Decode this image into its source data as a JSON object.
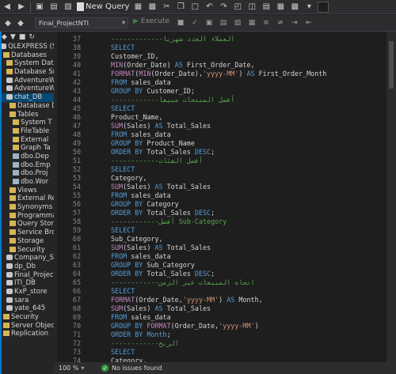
{
  "toolbar": {
    "new_query_label": "New Query"
  },
  "toolbar2": {
    "database_selected": "Final_ProjectNTI",
    "execute_label": "Execute"
  },
  "object_explorer": {
    "items": [
      {
        "label": "QLEXPRESS (SQL",
        "icon": "server-icon"
      },
      {
        "label": "Databases",
        "icon": "folder-icon"
      },
      {
        "label": "System Databa",
        "icon": "folder-icon"
      },
      {
        "label": "Database Snap",
        "icon": "folder-icon"
      },
      {
        "label": "AdventureWor",
        "icon": "database-icon"
      },
      {
        "label": "AdventureWor",
        "icon": "database-icon"
      },
      {
        "label": "chat_DB",
        "icon": "database-icon"
      },
      {
        "label": "Database D",
        "icon": "folder-icon"
      },
      {
        "label": "Tables",
        "icon": "folder-icon"
      },
      {
        "label": "System T",
        "icon": "folder-icon"
      },
      {
        "label": "FileTable",
        "icon": "folder-icon"
      },
      {
        "label": "External",
        "icon": "folder-icon"
      },
      {
        "label": "Graph Ta",
        "icon": "folder-icon"
      },
      {
        "label": "dbo.Dep",
        "icon": "table-icon"
      },
      {
        "label": "dbo.Emp",
        "icon": "table-icon"
      },
      {
        "label": "dbo.Proj",
        "icon": "table-icon"
      },
      {
        "label": "dbo.Wor",
        "icon": "table-icon"
      },
      {
        "label": "Views",
        "icon": "folder-icon"
      },
      {
        "label": "External Re",
        "icon": "folder-icon"
      },
      {
        "label": "Synonyms",
        "icon": "folder-icon"
      },
      {
        "label": "Programma",
        "icon": "folder-icon"
      },
      {
        "label": "Query Store",
        "icon": "folder-icon"
      },
      {
        "label": "Service Bro",
        "icon": "folder-icon"
      },
      {
        "label": "Storage",
        "icon": "folder-icon"
      },
      {
        "label": "Security",
        "icon": "folder-icon"
      },
      {
        "label": "Company_SD",
        "icon": "database-icon"
      },
      {
        "label": "dp_Db",
        "icon": "database-icon"
      },
      {
        "label": "Final_ProjectN",
        "icon": "database-icon"
      },
      {
        "label": "ITI_DB",
        "icon": "database-icon"
      },
      {
        "label": "KxP_store",
        "icon": "database-icon"
      },
      {
        "label": "sara",
        "icon": "database-icon"
      },
      {
        "label": "yate_645",
        "icon": "database-icon"
      },
      {
        "label": "Security",
        "icon": "folder-icon"
      },
      {
        "label": "Server Objects",
        "icon": "folder-icon"
      },
      {
        "label": "Replication",
        "icon": "folder-icon"
      }
    ]
  },
  "code_lines": [
    {
      "n": "37",
      "segs": [
        [
          "c",
          "-------------العملاء الجدد شهريا"
        ]
      ]
    },
    {
      "n": "38",
      "segs": [
        [
          "k",
          "SELECT"
        ]
      ]
    },
    {
      "n": "39",
      "segs": [
        [
          "t",
          "Customer_ID,"
        ]
      ]
    },
    {
      "n": "40",
      "segs": [
        [
          "f",
          "MIN"
        ],
        [
          "t",
          "(Order_Date) "
        ],
        [
          "k",
          "AS"
        ],
        [
          "t",
          " First_Order_Date,"
        ]
      ]
    },
    {
      "n": "41",
      "segs": [
        [
          "f",
          "FORMAT"
        ],
        [
          "t",
          "("
        ],
        [
          "f",
          "MIN"
        ],
        [
          "t",
          "(Order_Date),"
        ],
        [
          "s",
          "'yyyy-MM'"
        ],
        [
          "t",
          ") "
        ],
        [
          "k",
          "AS"
        ],
        [
          "t",
          " First_Order_Month"
        ]
      ]
    },
    {
      "n": "42",
      "segs": [
        [
          "k",
          "FROM"
        ],
        [
          "t",
          " sales_data"
        ]
      ]
    },
    {
      "n": "43",
      "segs": [
        [
          "k",
          "GROUP BY"
        ],
        [
          "t",
          " Customer_ID;"
        ]
      ]
    },
    {
      "n": "44",
      "segs": [
        [
          "c",
          "------------أفضل المنتجات مبيعا"
        ]
      ]
    },
    {
      "n": "45",
      "segs": [
        [
          "k",
          "SELECT"
        ]
      ]
    },
    {
      "n": "46",
      "segs": [
        [
          "t",
          "Product_Name,"
        ]
      ]
    },
    {
      "n": "47",
      "segs": [
        [
          "f",
          "SUM"
        ],
        [
          "t",
          "(Sales) "
        ],
        [
          "k",
          "AS"
        ],
        [
          "t",
          " Total_Sales"
        ]
      ]
    },
    {
      "n": "48",
      "segs": [
        [
          "k",
          "FROM"
        ],
        [
          "t",
          " sales_data"
        ]
      ]
    },
    {
      "n": "49",
      "segs": [
        [
          "k",
          "GROUP BY"
        ],
        [
          "t",
          " Product_Name"
        ]
      ]
    },
    {
      "n": "50",
      "segs": [
        [
          "k",
          "ORDER BY"
        ],
        [
          "t",
          " Total_Sales "
        ],
        [
          "k",
          "DESC"
        ],
        [
          "t",
          ";"
        ]
      ]
    },
    {
      "n": "51",
      "segs": [
        [
          "c",
          "------------أفضل الفئات"
        ]
      ]
    },
    {
      "n": "52",
      "segs": [
        [
          "k",
          "SELECT"
        ]
      ]
    },
    {
      "n": "53",
      "segs": [
        [
          "t",
          "Category,"
        ]
      ]
    },
    {
      "n": "54",
      "segs": [
        [
          "f",
          "SUM"
        ],
        [
          "t",
          "(Sales) "
        ],
        [
          "k",
          "AS"
        ],
        [
          "t",
          " Total_Sales"
        ]
      ]
    },
    {
      "n": "55",
      "segs": [
        [
          "k",
          "FROM"
        ],
        [
          "t",
          " sales_data"
        ]
      ]
    },
    {
      "n": "56",
      "segs": [
        [
          "k",
          "GROUP BY"
        ],
        [
          "t",
          " Category"
        ]
      ]
    },
    {
      "n": "57",
      "segs": [
        [
          "k",
          "ORDER BY"
        ],
        [
          "t",
          " Total_Sales "
        ],
        [
          "k",
          "DESC"
        ],
        [
          "t",
          ";"
        ]
      ]
    },
    {
      "n": "58",
      "segs": [
        [
          "c",
          "------------أفضل Sub-Category"
        ]
      ]
    },
    {
      "n": "59",
      "segs": [
        [
          "k",
          "SELECT"
        ]
      ]
    },
    {
      "n": "60",
      "segs": [
        [
          "t",
          "Sub_Category,"
        ]
      ]
    },
    {
      "n": "61",
      "segs": [
        [
          "f",
          "SUM"
        ],
        [
          "t",
          "(Sales) "
        ],
        [
          "k",
          "AS"
        ],
        [
          "t",
          " Total_Sales"
        ]
      ]
    },
    {
      "n": "62",
      "segs": [
        [
          "k",
          "FROM"
        ],
        [
          "t",
          " sales_data"
        ]
      ]
    },
    {
      "n": "63",
      "segs": [
        [
          "k",
          "GROUP BY"
        ],
        [
          "t",
          " Sub_Category"
        ]
      ]
    },
    {
      "n": "64",
      "segs": [
        [
          "k",
          "ORDER BY"
        ],
        [
          "t",
          " Total_Sales "
        ],
        [
          "k",
          "DESC"
        ],
        [
          "t",
          ";"
        ]
      ]
    },
    {
      "n": "65",
      "segs": [
        [
          "c",
          "------------اتجاه المبيعات عبر الزمن"
        ]
      ]
    },
    {
      "n": "66",
      "segs": [
        [
          "k",
          "SELECT"
        ]
      ]
    },
    {
      "n": "67",
      "segs": [
        [
          "f",
          "FORMAT"
        ],
        [
          "t",
          "(Order_Date,"
        ],
        [
          "s",
          "'yyyy-MM'"
        ],
        [
          "t",
          ") "
        ],
        [
          "k",
          "AS"
        ],
        [
          "t",
          " Month,"
        ]
      ]
    },
    {
      "n": "68",
      "segs": [
        [
          "f",
          "SUM"
        ],
        [
          "t",
          "(Sales) "
        ],
        [
          "k",
          "AS"
        ],
        [
          "t",
          " Total_Sales"
        ]
      ]
    },
    {
      "n": "69",
      "segs": [
        [
          "k",
          "FROM"
        ],
        [
          "t",
          " sales_data"
        ]
      ]
    },
    {
      "n": "70",
      "segs": [
        [
          "k",
          "GROUP BY"
        ],
        [
          "t",
          " "
        ],
        [
          "f",
          "FORMAT"
        ],
        [
          "t",
          "(Order_Date,"
        ],
        [
          "s",
          "'yyyy-MM'"
        ],
        [
          "t",
          ")"
        ]
      ]
    },
    {
      "n": "71",
      "segs": [
        [
          "k",
          "ORDER BY"
        ],
        [
          "t",
          " "
        ],
        [
          "k",
          "Month"
        ],
        [
          "t",
          ";"
        ]
      ]
    },
    {
      "n": "72",
      "segs": [
        [
          "c",
          "------------الربح"
        ]
      ]
    },
    {
      "n": "73",
      "segs": [
        [
          "k",
          "SELECT"
        ]
      ]
    },
    {
      "n": "74",
      "segs": [
        [
          "t",
          "Category,"
        ]
      ]
    }
  ],
  "status": {
    "zoom": "100 %",
    "issues": "No issues found"
  },
  "colors": {
    "keyword": "#569cd6",
    "function": "#c586c0",
    "string": "#ce9178",
    "comment": "#57a64a"
  }
}
